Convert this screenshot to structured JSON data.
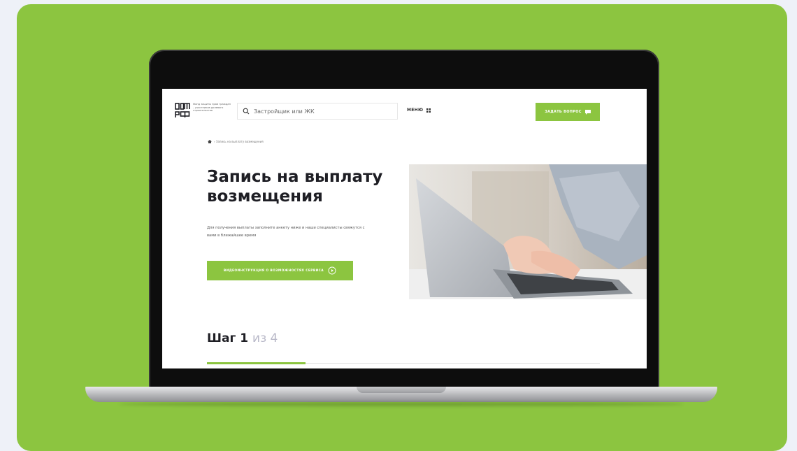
{
  "colors": {
    "brand_green": "#8cc540",
    "text_dark": "#1e1e24",
    "step_muted": "#b8b8c8"
  },
  "header": {
    "logo_name": "dom-rf-logo",
    "logo_tagline": "Фонд защиты прав граждан – участников долевого строительства",
    "search_placeholder": "Застройщик или ЖК",
    "menu_label": "МЕНЮ",
    "ask_button_label": "ЗАДАТЬ ВОПРОС"
  },
  "breadcrumb": {
    "current": "Запись на выплату возмещения"
  },
  "main": {
    "title": "Запись на выплату возмещения",
    "description": "Для получения выплаты заполните анкету ниже и наши специалисты свяжутся с вами в ближайшее время",
    "video_button_label": "ВИДЕОИНСТРУКЦИЯ О ВОЗМОЖНОСТЯХ СЕРВИСА"
  },
  "step": {
    "label": "Шаг 1",
    "of": "из 4",
    "current": 1,
    "total": 4,
    "progress": 0.25
  },
  "icons": [
    "search-icon",
    "menu-grid-icon",
    "chat-icon",
    "home-icon",
    "play-icon"
  ]
}
